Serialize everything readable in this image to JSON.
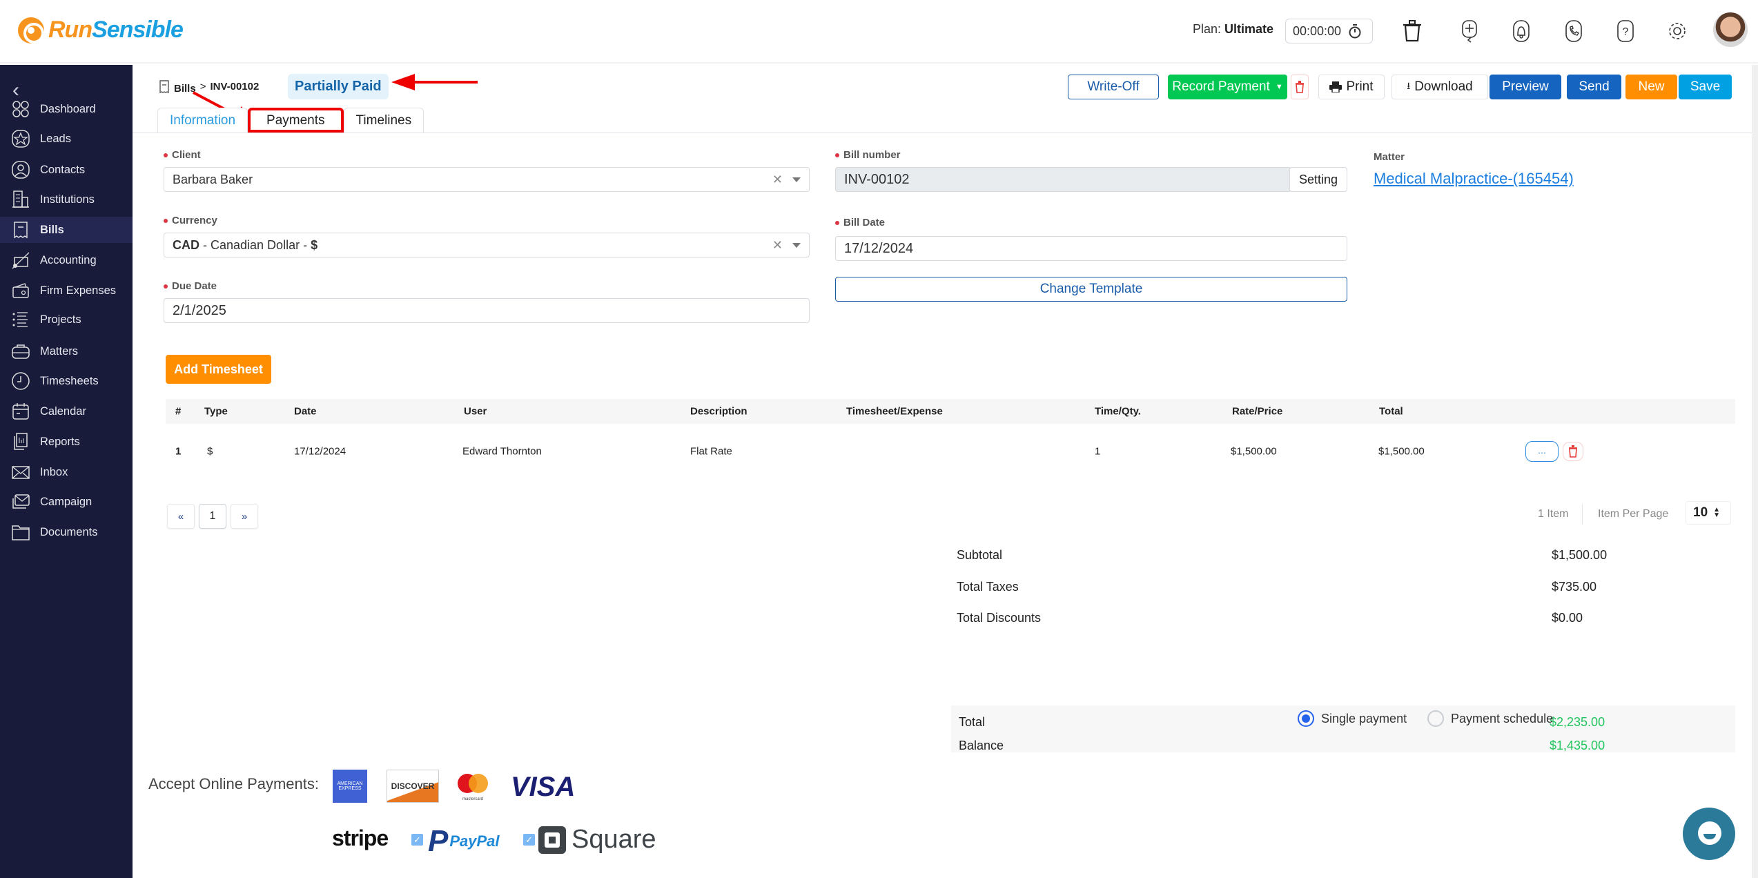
{
  "app": {
    "brand_part1": "Run",
    "brand_part2": "Sensible"
  },
  "topbar": {
    "plan_label": "Plan:",
    "plan_value": "Ultimate",
    "timer": "00:00:00",
    "icons": [
      "stopwatch-icon",
      "trash-icon",
      "add-task-icon",
      "notification-bell-icon",
      "phone-icon",
      "help-icon",
      "settings-gear-icon",
      "user-avatar"
    ]
  },
  "sidebar": {
    "items": [
      {
        "label": "Dashboard",
        "icon": "dashboard-icon"
      },
      {
        "label": "Leads",
        "icon": "star-icon"
      },
      {
        "label": "Contacts",
        "icon": "contact-icon"
      },
      {
        "label": "Institutions",
        "icon": "building-icon"
      },
      {
        "label": "Bills",
        "icon": "receipt-icon",
        "active": true
      },
      {
        "label": "Accounting",
        "icon": "chart-icon"
      },
      {
        "label": "Firm Expenses",
        "icon": "wallet-icon"
      },
      {
        "label": "Projects",
        "icon": "list-icon"
      },
      {
        "label": "Matters",
        "icon": "briefcase-icon"
      },
      {
        "label": "Timesheets",
        "icon": "clock-icon"
      },
      {
        "label": "Calendar",
        "icon": "calendar-icon"
      },
      {
        "label": "Reports",
        "icon": "reports-icon"
      },
      {
        "label": "Inbox",
        "icon": "mail-icon"
      },
      {
        "label": "Campaign",
        "icon": "campaign-icon"
      },
      {
        "label": "Documents",
        "icon": "folder-icon"
      }
    ]
  },
  "header": {
    "breadcrumb_root": "Bills",
    "breadcrumb_sep": ">",
    "breadcrumb_current": "INV-00102",
    "status_badge": "Partially Paid",
    "buttons": {
      "write_off": "Write-Off",
      "record_payment": "Record Payment",
      "print": "Print",
      "download": "Download",
      "preview": "Preview",
      "send": "Send",
      "new": "New",
      "save": "Save"
    }
  },
  "tabs": [
    {
      "label": "Information",
      "active": true
    },
    {
      "label": "Payments",
      "highlighted": true
    },
    {
      "label": "Timelines"
    }
  ],
  "form": {
    "client_label": "Client",
    "client_value": "Barbara Baker",
    "currency_label": "Currency",
    "currency_code": "CAD",
    "currency_rest": " - Canadian Dollar - ",
    "currency_symbol": "$",
    "due_date_label": "Due Date",
    "due_date_value": "2/1/2025",
    "bill_number_label": "Bill number",
    "bill_number_value": "INV-00102",
    "setting_button": "Setting",
    "bill_date_label": "Bill Date",
    "bill_date_value": "17/12/2024",
    "change_template_button": "Change Template",
    "matter_label": "Matter",
    "matter_value": "Medical Malpractice-(165454)"
  },
  "add_timesheet_button": "Add Timesheet",
  "table": {
    "columns": [
      "#",
      "Type",
      "Date",
      "User",
      "Description",
      "Timesheet/Expense",
      "Time/Qty.",
      "Rate/Price",
      "Total"
    ],
    "rows": [
      {
        "num": "1",
        "type": "$",
        "date": "17/12/2024",
        "user": "Edward Thornton",
        "description": "Flat Rate",
        "timesheet_expense": "",
        "qty": "1",
        "rate": "$1,500.00",
        "total": "$1,500.00",
        "more_button": "..."
      }
    ]
  },
  "pagination": {
    "prev": "«",
    "current": "1",
    "next": "»",
    "item_count": "1 Item",
    "per_page_label": "Item Per Page",
    "per_page_value": "10"
  },
  "summary": {
    "subtotal_label": "Subtotal",
    "subtotal": "$1,500.00",
    "taxes_label": "Total Taxes",
    "taxes": "$735.00",
    "discounts_label": "Total Discounts",
    "discounts": "$0.00",
    "total_label": "Total",
    "total": "$2,235.00",
    "balance_label": "Balance",
    "balance": "$1,435.00",
    "value_color": "#22c55e"
  },
  "payment_mode": {
    "single": "Single payment",
    "schedule": "Payment schedule",
    "selected": "single"
  },
  "online_payments": {
    "label": "Accept Online Payments:",
    "cards": [
      "AMERICAN EXPRESS",
      "DISCOVER",
      "mastercard",
      "VISA"
    ],
    "gateways": [
      {
        "name": "stripe",
        "checked": null
      },
      {
        "name": "PayPal",
        "checked": true
      },
      {
        "name": "Square",
        "checked": true
      }
    ]
  },
  "colors": {
    "sidebar_bg": "#181b3a",
    "primary_blue": "#1565c0",
    "success_green": "#00c853",
    "orange": "#ff8f00",
    "save_blue": "#00a0e3"
  }
}
